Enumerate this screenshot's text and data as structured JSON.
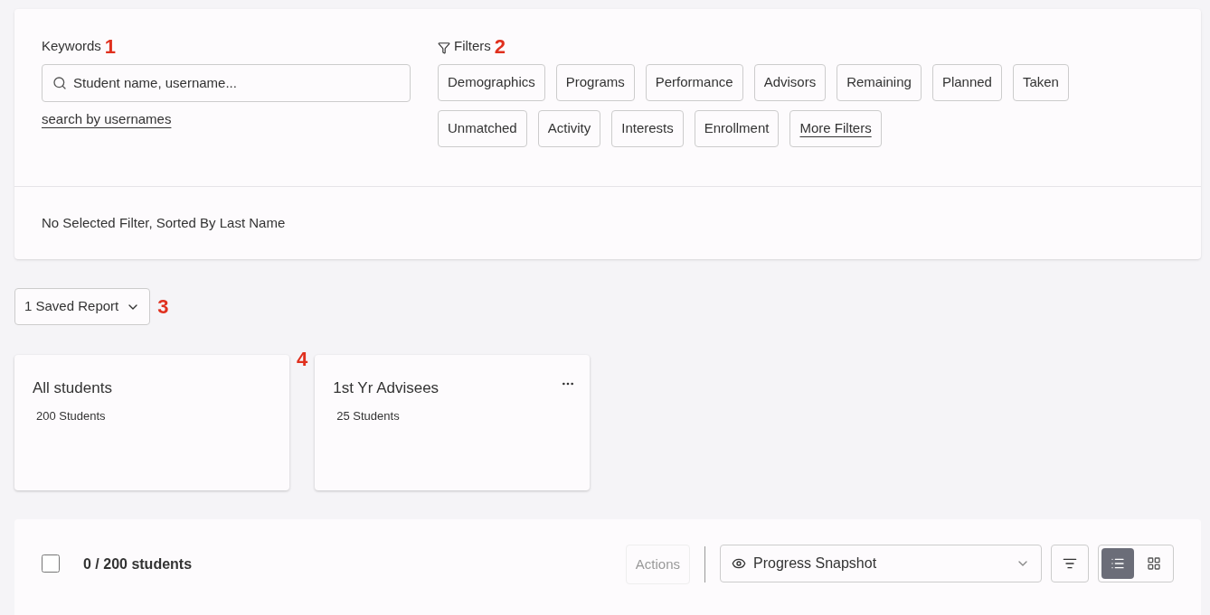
{
  "search": {
    "label": "Keywords",
    "callout": "1",
    "placeholder": "Student name, username...",
    "link": "search by usernames"
  },
  "filters": {
    "label": "Filters",
    "callout": "2",
    "items": [
      {
        "label": "Demographics",
        "kind": "chip"
      },
      {
        "label": "Programs",
        "kind": "chip"
      },
      {
        "label": "Performance",
        "kind": "chip"
      },
      {
        "label": "Advisors",
        "kind": "chip"
      },
      {
        "label": "Remaining",
        "kind": "chip"
      },
      {
        "label": "Planned",
        "kind": "chip"
      },
      {
        "label": "Taken",
        "kind": "chip"
      },
      {
        "label": "Unmatched",
        "kind": "chip"
      },
      {
        "label": "Activity",
        "kind": "chip"
      },
      {
        "label": "Interests",
        "kind": "chip"
      },
      {
        "label": "Enrollment",
        "kind": "chip"
      },
      {
        "label": "More Filters",
        "kind": "link"
      }
    ]
  },
  "status": "No Selected Filter, Sorted By Last Name",
  "saved_reports": {
    "label": "1 Saved Report",
    "callout": "3"
  },
  "cards_callout": "4",
  "cards": [
    {
      "title": "All students",
      "count": "200 Students",
      "menu": false
    },
    {
      "title": "1st Yr Advisees",
      "count": "25 Students",
      "menu": true
    }
  ],
  "toolbar": {
    "checked": false,
    "count": "0 / 200 students",
    "actions": "Actions",
    "view": "Progress Snapshot",
    "modes": [
      {
        "kind": "list",
        "selected": true
      },
      {
        "kind": "grid",
        "selected": false
      }
    ]
  }
}
